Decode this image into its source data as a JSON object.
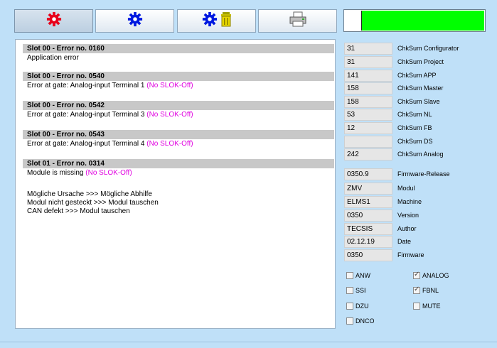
{
  "colors": {
    "background": "#bfe0f8",
    "accent_magenta": "#e000e0",
    "status_green": "#00ff00",
    "header_gray": "#c8c8c8"
  },
  "toolbar": {
    "buttons": [
      {
        "icon": "red-gear-icon",
        "color": "#e8001a"
      },
      {
        "icon": "blue-gear-icon",
        "color": "#0018e0"
      },
      {
        "icon": "blue-gear-icon",
        "icon2": "trash-bin-icon",
        "color": "#0018e0"
      },
      {
        "icon": "printer-icon"
      }
    ],
    "active_index": 0
  },
  "status": {
    "level": 0.87
  },
  "errors": [
    {
      "header": "Slot 00 -  Error no.  0160",
      "text": "Application error",
      "suffix": ""
    },
    {
      "header": "Slot 00 -  Error no.  0540",
      "text": "Error at gate: Analog-input Terminal 1 ",
      "suffix": "(No SLOK-Off)"
    },
    {
      "header": "Slot 00 -  Error no.  0542",
      "text": "Error at gate: Analog-input Terminal 3 ",
      "suffix": "(No SLOK-Off)"
    },
    {
      "header": "Slot 00 -  Error no.  0543",
      "text": "Error at gate: Analog-input Terminal 4 ",
      "suffix": "(No SLOK-Off)"
    },
    {
      "header": "Slot 01 -  Error no.  0314",
      "text": "Module is missing ",
      "suffix": "(No SLOK-Off)"
    }
  ],
  "hints": [
    "Mögliche Ursache  >>>  Mögliche Abhilfe",
    "Modul nicht gesteckt  >>>  Modul tauschen",
    "CAN defekt  >>>  Modul tauschen"
  ],
  "checksums": [
    {
      "value": "31",
      "label": "ChkSum Configurator"
    },
    {
      "value": "31",
      "label": "ChkSum Project"
    },
    {
      "value": "141",
      "label": "ChkSum APP"
    },
    {
      "value": "158",
      "label": "ChkSum Master"
    },
    {
      "value": "158",
      "label": "ChkSum Slave"
    },
    {
      "value": "53",
      "label": "ChkSum NL"
    },
    {
      "value": "12",
      "label": "ChkSum FB"
    },
    {
      "value": "",
      "label": "ChkSum DS"
    },
    {
      "value": "242",
      "label": "ChkSum Analog"
    }
  ],
  "info": [
    {
      "value": "0350.9",
      "label": "Firmware-Release"
    },
    {
      "value": "ZMV",
      "label": "Modul"
    },
    {
      "value": "ELMS1",
      "label": "Machine"
    },
    {
      "value": "0350",
      "label": "Version"
    },
    {
      "value": "TECSIS",
      "label": "Author"
    },
    {
      "value": "02.12.19",
      "label": "Date"
    },
    {
      "value": "0350",
      "label": "Firmware"
    }
  ],
  "flags": [
    {
      "label": "ANW",
      "checked": false
    },
    {
      "label": "ANALOG",
      "checked": true
    },
    {
      "label": "SSI",
      "checked": false
    },
    {
      "label": "FBNL",
      "checked": true
    },
    {
      "label": "DZU",
      "checked": false
    },
    {
      "label": "MUTE",
      "checked": false
    },
    {
      "label": "DNCO",
      "checked": false
    }
  ]
}
